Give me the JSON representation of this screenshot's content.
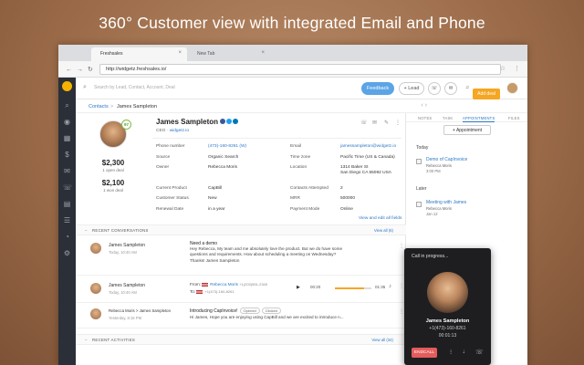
{
  "headline": "360° Customer view with integrated Email and Phone",
  "browser": {
    "tab_active": "Freshsales",
    "tab_other": "New Tab",
    "url": "http://widgetz.freshsales.io/"
  },
  "topbar": {
    "search_placeholder": "Search by Lead, Contact, Account, Deal",
    "feedback": "Feedback",
    "add_lead": "+ Lead"
  },
  "breadcrumb": {
    "section": "Contacts",
    "separator": ">",
    "current": "James Sampleton"
  },
  "add_deal": "Add deal",
  "contact": {
    "name": "James Sampleton",
    "role": "CEO",
    "role_sep": "·",
    "company": "widgetz.io",
    "score": "97",
    "won_amount": "$2,300",
    "won_label": "1 open deal",
    "open_amount": "$2,100",
    "open_label": "1 won deal"
  },
  "fields_left": [
    {
      "label": "Phone number",
      "value": "(473)-160-8261 (W)",
      "link": true
    },
    {
      "label": "Source",
      "value": "Organic Search"
    },
    {
      "label": "Owner",
      "value": "Rebecca Moris"
    },
    {
      "label": "Current Product",
      "value": "CapBill"
    },
    {
      "label": "Customer Status",
      "value": "New"
    },
    {
      "label": "Renewal Date",
      "value": "in a year"
    }
  ],
  "fields_right": [
    {
      "label": "Email",
      "value": "jamessampleton@widgetz.io",
      "link": true
    },
    {
      "label": "Time zone",
      "value": "Pacific Time (US & Canada)"
    },
    {
      "label": "Location",
      "value": "1314 Baker St\nSan Diego CA 55092 USA"
    },
    {
      "label": "Contacts Attempted",
      "value": "2"
    },
    {
      "label": "MRR",
      "value": "500000"
    },
    {
      "label": "Payment Mode",
      "value": "Online"
    }
  ],
  "view_all": "View and edit all fields",
  "recent_conversations": {
    "title": "RECENT CONVERSATIONS",
    "link": "View all (6)"
  },
  "conversations": [
    {
      "name": "James Sampleton",
      "date": "Today, 10:40 AM",
      "subject": "Need a demo",
      "body": "Hey Rebecca, My team and me absolutely love the product. But we do have some questions and requirements. How about scheduling a meeting on Wednesday? Thanks! James Sampleton"
    },
    {
      "name": "James Sampleton",
      "date": "Today, 10:40 AM",
      "from_label": "From:",
      "from_name": "Rebecca Moris",
      "from_num": "+1(203)551-2345",
      "to_label": "To:",
      "to_num": "+1(473)-160-8261",
      "t_start": "00:20",
      "t_end": "01:35"
    },
    {
      "name": "Rebecca Moris",
      "name_to": "> James Sampleton",
      "date": "Yesterday, 8:15 PM",
      "subject": "Introducing CapInvoice!",
      "tag1": "Opened",
      "tag2": "Clicked",
      "body": "Hi James, Hope you are enjoying using CapBill and we are excited to introduce n..."
    }
  ],
  "recent_activities": {
    "title": "RECENT ACTIVITIES",
    "link": "View all (34)"
  },
  "right_tabs": [
    "NOTES",
    "TASK",
    "APPOINTMENTS",
    "FILES"
  ],
  "appointment_btn": "+ Appointment",
  "appointments": [
    {
      "day": "Today",
      "title": "Demo of CapInvoice",
      "who": "Rebecca Moris",
      "time": "3:00 PM"
    },
    {
      "day": "Later",
      "title": "Meeting with James",
      "who": "Rebecca Moris",
      "time": "Jan 12"
    }
  ],
  "call": {
    "status": "Call in progress...",
    "name": "James Sampleton",
    "number": "+1(473)-160-8261",
    "timer": "00:01:13",
    "end": "ENDCALL"
  },
  "colors": {
    "accent": "#2b78c5",
    "feedback": "#5ba4e6",
    "add_deal": "#f5a623",
    "endcall": "#e45c5c",
    "sidebar": "#2b2f37"
  }
}
